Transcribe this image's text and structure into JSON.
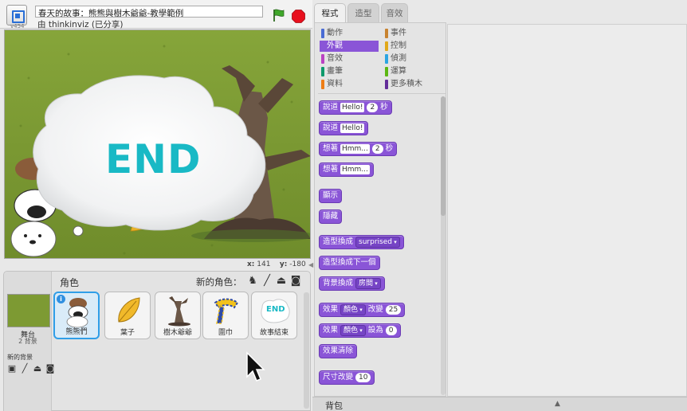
{
  "header": {
    "version": "v454",
    "project_title": "春天的故事：熊熊與樹木爺爺-教學範例",
    "owner": "由 thinkinviz (已分享)"
  },
  "stage": {
    "end_text": "END",
    "coords_x_label": "x:",
    "coords_x": "141",
    "coords_y_label": "y:",
    "coords_y": "-180"
  },
  "sprites_panel": {
    "title": "角色",
    "new_sprite_label": "新的角色：",
    "stage_label": "舞台",
    "stage_sub": "2 背景",
    "new_backdrop_label": "新的背景",
    "sprites": [
      {
        "name": "熊熊們",
        "selected": true
      },
      {
        "name": "葉子",
        "selected": false
      },
      {
        "name": "樹木爺爺",
        "selected": false
      },
      {
        "name": "圍巾",
        "selected": false
      },
      {
        "name": "故事結束",
        "selected": false
      }
    ],
    "end_thumb_text": "END"
  },
  "tabs": [
    {
      "label": "程式",
      "active": true
    },
    {
      "label": "造型",
      "active": false
    },
    {
      "label": "音效",
      "active": false
    }
  ],
  "categories": [
    {
      "label": "動作",
      "color": "#4a6cd4"
    },
    {
      "label": "事件",
      "color": "#c88330"
    },
    {
      "label": "外觀",
      "color": "#8a55d7",
      "active": true
    },
    {
      "label": "控制",
      "color": "#e1a91a"
    },
    {
      "label": "音效",
      "color": "#bb42c3"
    },
    {
      "label": "偵測",
      "color": "#2ca5e2"
    },
    {
      "label": "畫筆",
      "color": "#0e9a6c"
    },
    {
      "label": "運算",
      "color": "#5cb712"
    },
    {
      "label": "資料",
      "color": "#ee7d16"
    },
    {
      "label": "更多積木",
      "color": "#632d99"
    }
  ],
  "blocks": {
    "say_for": {
      "label": "說道",
      "arg": "Hello!",
      "secs": "2",
      "unit": "秒"
    },
    "say": {
      "label": "說道",
      "arg": "Hello!"
    },
    "think_for": {
      "label": "想著",
      "arg": "Hmm...",
      "secs": "2",
      "unit": "秒"
    },
    "think": {
      "label": "想著",
      "arg": "Hmm..."
    },
    "show": {
      "label": "顯示"
    },
    "hide": {
      "label": "隱藏"
    },
    "switch_costume": {
      "label": "造型換成",
      "arg": "surprised"
    },
    "next_costume": {
      "label": "造型換成下一個"
    },
    "switch_backdrop": {
      "label": "背景換成",
      "arg": "房間"
    },
    "change_effect": {
      "label": "效果",
      "arg": "顏色",
      "verb": "改變",
      "num": "25"
    },
    "set_effect": {
      "label": "效果",
      "arg": "顏色",
      "verb": "設為",
      "num": "0"
    },
    "clear_effects": {
      "label": "效果清除"
    },
    "change_size": {
      "label": "尺寸改變",
      "num": "10"
    }
  },
  "backpack": {
    "label": "背包"
  }
}
